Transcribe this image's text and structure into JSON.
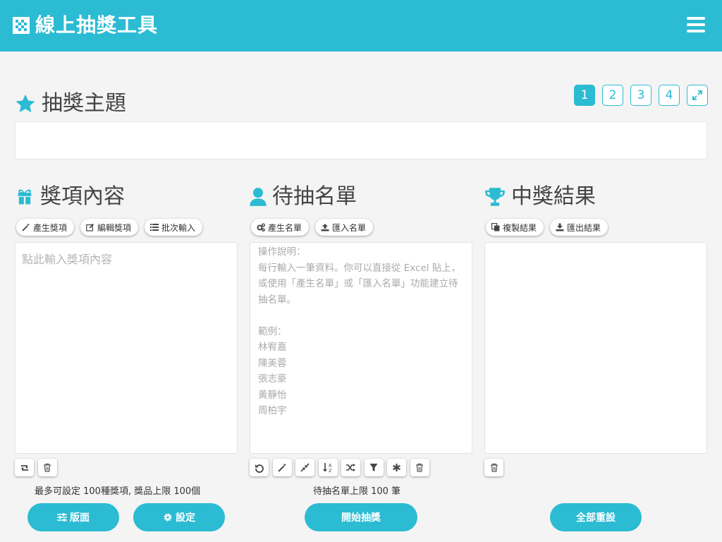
{
  "header": {
    "title": "線上抽獎工具",
    "logo_icon": "checkerboard-icon",
    "menu_icon": "hamburger-icon"
  },
  "topic": {
    "title": "抽獎主題",
    "icon": "star-icon",
    "value": ""
  },
  "pager": {
    "pages": [
      "1",
      "2",
      "3",
      "4"
    ],
    "active": "1",
    "fullscreen_icon": "expand-icon"
  },
  "prizes": {
    "title": "獎項內容",
    "icon": "gift-icon",
    "buttons": {
      "generate": "產生獎項",
      "edit": "編輯獎項",
      "batch": "批次輸入"
    },
    "placeholder": "點此輸入獎項內容",
    "note": "最多可設定 100種獎項, 獎品上限 100個"
  },
  "candidates": {
    "title": "待抽名單",
    "icon": "user-icon",
    "buttons": {
      "generate": "產生名單",
      "import": "匯入名單"
    },
    "help": "操作說明：\n每行輸入一筆資料。你可以直接從 Excel 貼上，或使用「產生名單」或「匯入名單」功能建立待抽名單。\n\n範例：\n林宥嘉\n陳美蓉\n張志豪\n黃靜怡\n周柏宇",
    "note": "待抽名單上限 100 筆"
  },
  "results": {
    "title": "中獎結果",
    "icon": "trophy-icon",
    "buttons": {
      "copy": "複製結果",
      "export": "匯出結果"
    }
  },
  "actions": {
    "layout": "版面",
    "settings": "設定",
    "start": "開始抽獎",
    "reset": "全部重設"
  },
  "colors": {
    "accent": "#2bbbd3",
    "background": "#f4f4f4"
  }
}
